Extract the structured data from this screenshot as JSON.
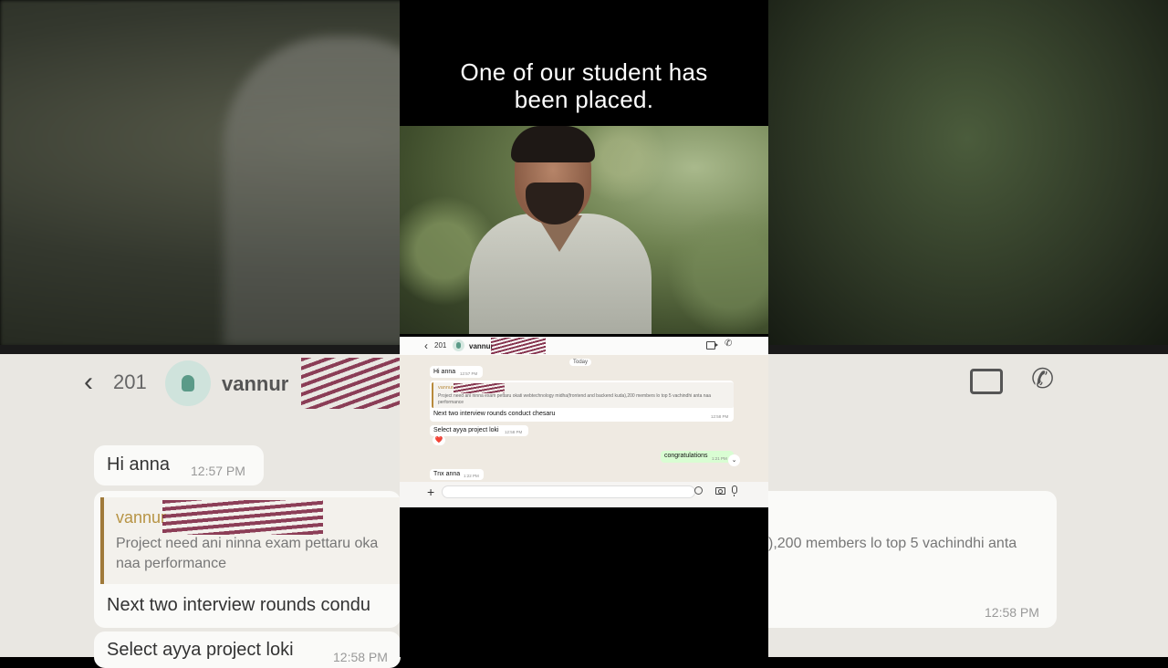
{
  "caption": {
    "line1": "One of our student has",
    "line2": "been placed."
  },
  "chat": {
    "back_count": "201",
    "contact_name": "vannur",
    "date_divider": "Today",
    "messages": [
      {
        "text": "Hi anna",
        "time": "12:57 PM",
        "direction": "incoming"
      },
      {
        "quote_author": "vannur",
        "quote_text": "Project need ani ninna exam pettaru okati webtechnology midha(frontend and backend kuda),200 members lo top 5 vachindhi anta naa performance",
        "text": "Next two interview rounds conduct chesaru",
        "time": "12:58 PM",
        "direction": "incoming"
      },
      {
        "text": "Select ayya project loki",
        "time": "12:58 PM",
        "direction": "incoming",
        "reaction": "❤️"
      },
      {
        "text": "congratulations",
        "time": "1:21 PM",
        "direction": "outgoing"
      },
      {
        "text": "Tnx anna",
        "time": "1:22 PM",
        "direction": "incoming"
      }
    ]
  },
  "background": {
    "back_count": "201",
    "contact_name": "vannur",
    "msg1": "Hi anna",
    "msg1_time": "12:57 PM",
    "quote_author": "vannur",
    "quote_left": "Project need ani ninna exam pettaru oka",
    "quote_left_2": "naa performance",
    "quote_right": "),200 members lo top 5 vachindhi anta",
    "msg2_partial": "Next two interview rounds condu",
    "msg2_time": "12:58 PM",
    "msg3_partial": "Select ayya project loki",
    "msg3_time": "12:58 PM"
  },
  "colors": {
    "outgoing_bubble": "#d9fdd3",
    "quote_accent": "#b88a3c",
    "chat_bg": "#efeae2"
  },
  "icons": [
    "back-chevron-icon",
    "contact-avatar-icon",
    "video-call-icon",
    "phone-call-icon",
    "plus-icon",
    "sticker-icon",
    "camera-icon",
    "mic-icon",
    "scroll-down-icon"
  ]
}
